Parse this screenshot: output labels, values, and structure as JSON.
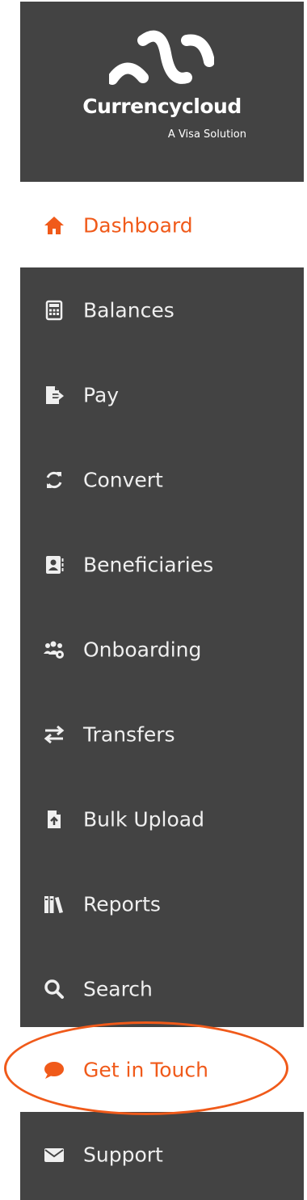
{
  "brand": {
    "name": "Currencycloud",
    "tagline": "A Visa Solution"
  },
  "colors": {
    "sidebar_bg": "#434343",
    "accent": "#f05a1a",
    "text_light": "#efefef"
  },
  "nav": {
    "items": [
      {
        "label": "Dashboard",
        "icon": "home-icon",
        "active": true
      },
      {
        "label": "Balances",
        "icon": "calculator-icon"
      },
      {
        "label": "Pay",
        "icon": "file-export-icon"
      },
      {
        "label": "Convert",
        "icon": "refresh-icon"
      },
      {
        "label": "Beneficiaries",
        "icon": "contact-book-icon"
      },
      {
        "label": "Onboarding",
        "icon": "users-gear-icon"
      },
      {
        "label": "Transfers",
        "icon": "exchange-arrows-icon"
      },
      {
        "label": "Bulk Upload",
        "icon": "file-upload-icon"
      },
      {
        "label": "Reports",
        "icon": "books-icon"
      },
      {
        "label": "Search",
        "icon": "search-icon"
      },
      {
        "label": "Get in Touch",
        "icon": "chat-bubble-icon",
        "highlighted": true
      },
      {
        "label": "Support",
        "icon": "envelope-icon"
      }
    ]
  }
}
